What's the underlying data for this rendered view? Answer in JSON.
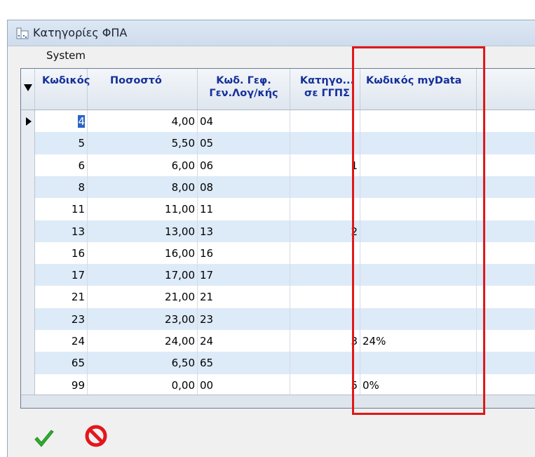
{
  "window": {
    "title": "Κατηγορίες ΦΠΑ",
    "menu": "System"
  },
  "grid": {
    "columns": [
      {
        "label": "Κωδικός"
      },
      {
        "label": "Ποσοστό"
      },
      {
        "label": "Κωδ. Γεφ. Γεν.Λογ/κής",
        "line1": "Κωδ. Γεφ.",
        "line2": "Γεν.Λογ/κής"
      },
      {
        "label": "Κατηγο... σε ΓΓΠΣ",
        "line1": "Κατηγο...",
        "line2": "σε ΓΓΠΣ"
      },
      {
        "label": "Κωδικός myData"
      }
    ],
    "rows": [
      {
        "code": "4",
        "rate": "4,00",
        "ledger": "04",
        "category": "",
        "mydata": ""
      },
      {
        "code": "5",
        "rate": "5,50",
        "ledger": "05",
        "category": "",
        "mydata": ""
      },
      {
        "code": "6",
        "rate": "6,00",
        "ledger": "06",
        "category": "1",
        "mydata": ""
      },
      {
        "code": "8",
        "rate": "8,00",
        "ledger": "08",
        "category": "",
        "mydata": ""
      },
      {
        "code": "11",
        "rate": "11,00",
        "ledger": "11",
        "category": "",
        "mydata": ""
      },
      {
        "code": "13",
        "rate": "13,00",
        "ledger": "13",
        "category": "2",
        "mydata": ""
      },
      {
        "code": "16",
        "rate": "16,00",
        "ledger": "16",
        "category": "",
        "mydata": ""
      },
      {
        "code": "17",
        "rate": "17,00",
        "ledger": "17",
        "category": "",
        "mydata": ""
      },
      {
        "code": "21",
        "rate": "21,00",
        "ledger": "21",
        "category": "",
        "mydata": ""
      },
      {
        "code": "23",
        "rate": "23,00",
        "ledger": "23",
        "category": "",
        "mydata": ""
      },
      {
        "code": "24",
        "rate": "24,00",
        "ledger": "24",
        "category": "3",
        "mydata": "24%"
      },
      {
        "code": "65",
        "rate": "6,50",
        "ledger": "65",
        "category": "",
        "mydata": ""
      },
      {
        "code": "99",
        "rate": "0,00",
        "ledger": "00",
        "category": "5",
        "mydata": "0%"
      }
    ]
  },
  "buttons": {
    "ok_icon": "check-icon",
    "cancel_icon": "cancel-icon"
  },
  "colors": {
    "header_text": "#16309a",
    "row_alt": "#ddeaf8",
    "highlight": "#e01818",
    "ok": "#2fae2f",
    "cancel": "#e3171b"
  }
}
